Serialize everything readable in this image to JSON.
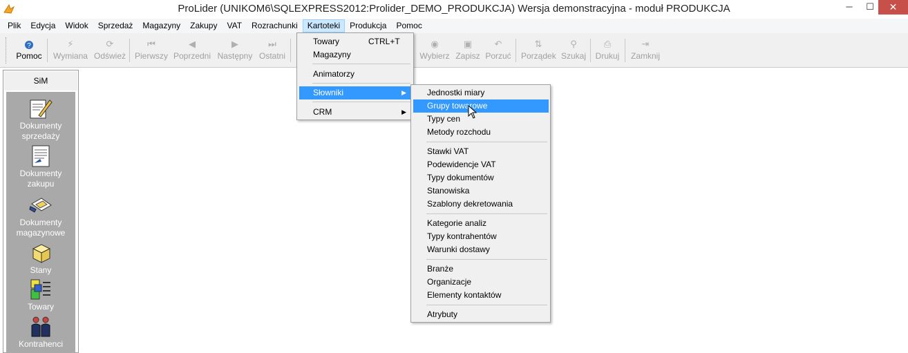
{
  "window": {
    "title": "ProLider  (UNIKOM6\\SQLEXPRESS2012:Prolider_DEMO_PRODUKCJA) Wersja demonstracyjna - moduł PRODUKCJA",
    "minimize": "─",
    "maximize": "☐",
    "close": "✕"
  },
  "menubar": [
    {
      "label": "Plik"
    },
    {
      "label": "Edycja"
    },
    {
      "label": "Widok"
    },
    {
      "label": "Sprzedaż"
    },
    {
      "label": "Magazyny"
    },
    {
      "label": "Zakupy"
    },
    {
      "label": "VAT"
    },
    {
      "label": "Rozrachunki"
    },
    {
      "label": "Kartoteki"
    },
    {
      "label": "Produkcja"
    },
    {
      "label": "Pomoc"
    }
  ],
  "toolbar": {
    "pomoc": "Pomoc",
    "wymiana": "Wymiana",
    "odswiez": "Odśwież",
    "pierwszy": "Pierwszy",
    "poprzedni": "Poprzedni",
    "nastepny": "Następny",
    "ostatni": "Ostatni",
    "wybierz": "Wybierz",
    "zapisz": "Zapisz",
    "porzuc": "Porzuć",
    "porzadek": "Porządek",
    "szukaj": "Szukaj",
    "drukuj": "Drukuj",
    "zamknij": "Zamknij"
  },
  "sidepanel": {
    "header": "SiM",
    "items": [
      {
        "label": "Dokumenty sprzedaży",
        "icon": "pen-document-icon"
      },
      {
        "label": "Dokumenty zakupu",
        "icon": "document-icon"
      },
      {
        "label": "Dokumenty magazynowe",
        "icon": "hand-document-icon"
      },
      {
        "label": "Stany",
        "icon": "box-icon"
      },
      {
        "label": "Towary",
        "icon": "goods-icon"
      },
      {
        "label": "Kontrahenci",
        "icon": "people-icon"
      }
    ]
  },
  "kartoteki_menu": {
    "towary": "Towary",
    "towary_shortcut": "CTRL+T",
    "magazyny": "Magazyny",
    "animatorzy": "Animatorzy",
    "slowniki": "Słowniki",
    "crm": "CRM"
  },
  "slowniki_menu": {
    "jednostki_miary": "Jednostki miary",
    "grupy_towarowe": "Grupy towarowe",
    "typy_cen": "Typy cen",
    "metody_rozchodu": "Metody rozchodu",
    "stawki_vat": "Stawki VAT",
    "podewidencje_vat": "Podewidencje VAT",
    "typy_dokumentow": "Typy dokumentów",
    "stanowiska": "Stanowiska",
    "szablony_dekretowania": "Szablony dekretowania",
    "kategorie_analiz": "Kategorie analiz",
    "typy_kontrahentow": "Typy kontrahentów",
    "warunki_dostawy": "Warunki dostawy",
    "branze": "Branże",
    "organizacje": "Organizacje",
    "elementy_kontaktow": "Elementy kontaktów",
    "atrybuty": "Atrybuty"
  },
  "colors": {
    "highlight": "#3399ff",
    "menu_active": "#cce8ff",
    "side_panel_bg": "#a9a9a9",
    "close_button": "#c7504b"
  }
}
